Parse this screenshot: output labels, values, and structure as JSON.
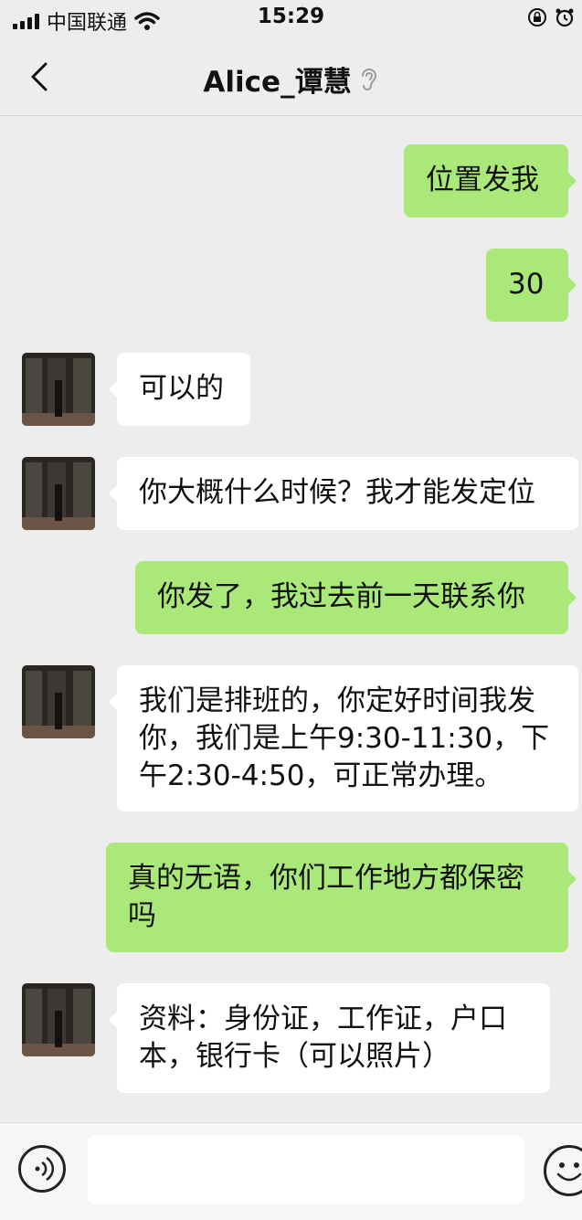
{
  "status_bar": {
    "carrier": "中国联通",
    "time": "15:29"
  },
  "nav": {
    "title": "Alice_谭慧",
    "icons": [
      "back-chevron-icon",
      "ear-icon"
    ]
  },
  "messages": [
    {
      "side": "out",
      "text": "位置发我"
    },
    {
      "side": "out",
      "text": "30"
    },
    {
      "side": "in",
      "text": "可以的"
    },
    {
      "side": "in",
      "text": "你大概什么时候？我才能发定位"
    },
    {
      "side": "out",
      "text": "你发了，我过去前一天联系你"
    },
    {
      "side": "in",
      "text": "我们是排班的，你定好时间我发你，我们是上午9:30-11:30，下午2:30-4:50，可正常办理。"
    },
    {
      "side": "out",
      "text": "真的无语，你们工作地方都保密吗"
    },
    {
      "side": "in",
      "text": "资料：身份证，工作证，户口本，银行卡（可以照片）"
    }
  ],
  "input": {
    "value": "",
    "icons": [
      "voice-icon",
      "emoji-icon"
    ]
  },
  "colors": {
    "background": "#ededed",
    "outgoing_bubble": "#a9e879",
    "incoming_bubble": "#ffffff"
  }
}
